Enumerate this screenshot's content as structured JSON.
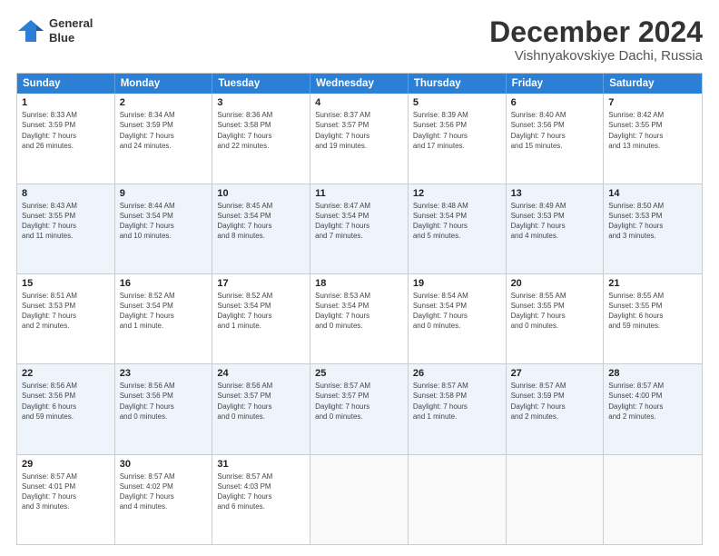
{
  "header": {
    "logo_line1": "General",
    "logo_line2": "Blue",
    "month_title": "December 2024",
    "location": "Vishnyakovskiye Dachi, Russia"
  },
  "days_of_week": [
    "Sunday",
    "Monday",
    "Tuesday",
    "Wednesday",
    "Thursday",
    "Friday",
    "Saturday"
  ],
  "rows": [
    [
      {
        "day": "1",
        "lines": [
          "Sunrise: 8:33 AM",
          "Sunset: 3:59 PM",
          "Daylight: 7 hours",
          "and 26 minutes."
        ]
      },
      {
        "day": "2",
        "lines": [
          "Sunrise: 8:34 AM",
          "Sunset: 3:59 PM",
          "Daylight: 7 hours",
          "and 24 minutes."
        ]
      },
      {
        "day": "3",
        "lines": [
          "Sunrise: 8:36 AM",
          "Sunset: 3:58 PM",
          "Daylight: 7 hours",
          "and 22 minutes."
        ]
      },
      {
        "day": "4",
        "lines": [
          "Sunrise: 8:37 AM",
          "Sunset: 3:57 PM",
          "Daylight: 7 hours",
          "and 19 minutes."
        ]
      },
      {
        "day": "5",
        "lines": [
          "Sunrise: 8:39 AM",
          "Sunset: 3:56 PM",
          "Daylight: 7 hours",
          "and 17 minutes."
        ]
      },
      {
        "day": "6",
        "lines": [
          "Sunrise: 8:40 AM",
          "Sunset: 3:56 PM",
          "Daylight: 7 hours",
          "and 15 minutes."
        ]
      },
      {
        "day": "7",
        "lines": [
          "Sunrise: 8:42 AM",
          "Sunset: 3:55 PM",
          "Daylight: 7 hours",
          "and 13 minutes."
        ]
      }
    ],
    [
      {
        "day": "8",
        "lines": [
          "Sunrise: 8:43 AM",
          "Sunset: 3:55 PM",
          "Daylight: 7 hours",
          "and 11 minutes."
        ]
      },
      {
        "day": "9",
        "lines": [
          "Sunrise: 8:44 AM",
          "Sunset: 3:54 PM",
          "Daylight: 7 hours",
          "and 10 minutes."
        ]
      },
      {
        "day": "10",
        "lines": [
          "Sunrise: 8:45 AM",
          "Sunset: 3:54 PM",
          "Daylight: 7 hours",
          "and 8 minutes."
        ]
      },
      {
        "day": "11",
        "lines": [
          "Sunrise: 8:47 AM",
          "Sunset: 3:54 PM",
          "Daylight: 7 hours",
          "and 7 minutes."
        ]
      },
      {
        "day": "12",
        "lines": [
          "Sunrise: 8:48 AM",
          "Sunset: 3:54 PM",
          "Daylight: 7 hours",
          "and 5 minutes."
        ]
      },
      {
        "day": "13",
        "lines": [
          "Sunrise: 8:49 AM",
          "Sunset: 3:53 PM",
          "Daylight: 7 hours",
          "and 4 minutes."
        ]
      },
      {
        "day": "14",
        "lines": [
          "Sunrise: 8:50 AM",
          "Sunset: 3:53 PM",
          "Daylight: 7 hours",
          "and 3 minutes."
        ]
      }
    ],
    [
      {
        "day": "15",
        "lines": [
          "Sunrise: 8:51 AM",
          "Sunset: 3:53 PM",
          "Daylight: 7 hours",
          "and 2 minutes."
        ]
      },
      {
        "day": "16",
        "lines": [
          "Sunrise: 8:52 AM",
          "Sunset: 3:54 PM",
          "Daylight: 7 hours",
          "and 1 minute."
        ]
      },
      {
        "day": "17",
        "lines": [
          "Sunrise: 8:52 AM",
          "Sunset: 3:54 PM",
          "Daylight: 7 hours",
          "and 1 minute."
        ]
      },
      {
        "day": "18",
        "lines": [
          "Sunrise: 8:53 AM",
          "Sunset: 3:54 PM",
          "Daylight: 7 hours",
          "and 0 minutes."
        ]
      },
      {
        "day": "19",
        "lines": [
          "Sunrise: 8:54 AM",
          "Sunset: 3:54 PM",
          "Daylight: 7 hours",
          "and 0 minutes."
        ]
      },
      {
        "day": "20",
        "lines": [
          "Sunrise: 8:55 AM",
          "Sunset: 3:55 PM",
          "Daylight: 7 hours",
          "and 0 minutes."
        ]
      },
      {
        "day": "21",
        "lines": [
          "Sunrise: 8:55 AM",
          "Sunset: 3:55 PM",
          "Daylight: 6 hours",
          "and 59 minutes."
        ]
      }
    ],
    [
      {
        "day": "22",
        "lines": [
          "Sunrise: 8:56 AM",
          "Sunset: 3:56 PM",
          "Daylight: 6 hours",
          "and 59 minutes."
        ]
      },
      {
        "day": "23",
        "lines": [
          "Sunrise: 8:56 AM",
          "Sunset: 3:56 PM",
          "Daylight: 7 hours",
          "and 0 minutes."
        ]
      },
      {
        "day": "24",
        "lines": [
          "Sunrise: 8:56 AM",
          "Sunset: 3:57 PM",
          "Daylight: 7 hours",
          "and 0 minutes."
        ]
      },
      {
        "day": "25",
        "lines": [
          "Sunrise: 8:57 AM",
          "Sunset: 3:57 PM",
          "Daylight: 7 hours",
          "and 0 minutes."
        ]
      },
      {
        "day": "26",
        "lines": [
          "Sunrise: 8:57 AM",
          "Sunset: 3:58 PM",
          "Daylight: 7 hours",
          "and 1 minute."
        ]
      },
      {
        "day": "27",
        "lines": [
          "Sunrise: 8:57 AM",
          "Sunset: 3:59 PM",
          "Daylight: 7 hours",
          "and 2 minutes."
        ]
      },
      {
        "day": "28",
        "lines": [
          "Sunrise: 8:57 AM",
          "Sunset: 4:00 PM",
          "Daylight: 7 hours",
          "and 2 minutes."
        ]
      }
    ],
    [
      {
        "day": "29",
        "lines": [
          "Sunrise: 8:57 AM",
          "Sunset: 4:01 PM",
          "Daylight: 7 hours",
          "and 3 minutes."
        ]
      },
      {
        "day": "30",
        "lines": [
          "Sunrise: 8:57 AM",
          "Sunset: 4:02 PM",
          "Daylight: 7 hours",
          "and 4 minutes."
        ]
      },
      {
        "day": "31",
        "lines": [
          "Sunrise: 8:57 AM",
          "Sunset: 4:03 PM",
          "Daylight: 7 hours",
          "and 6 minutes."
        ]
      },
      {
        "day": "",
        "lines": []
      },
      {
        "day": "",
        "lines": []
      },
      {
        "day": "",
        "lines": []
      },
      {
        "day": "",
        "lines": []
      }
    ]
  ]
}
